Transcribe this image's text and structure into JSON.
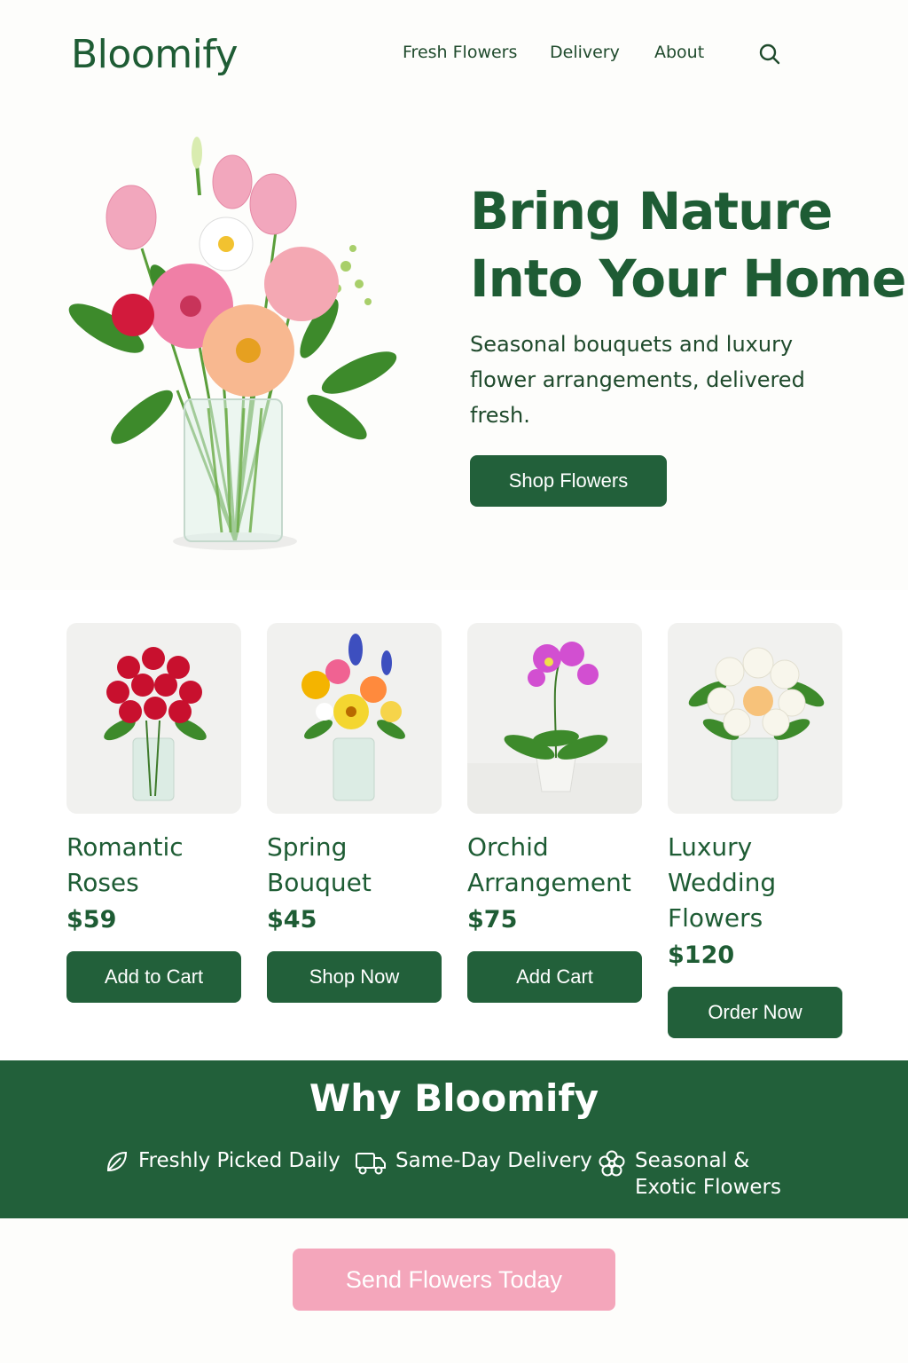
{
  "header": {
    "logo": "Bloomify",
    "nav": [
      "Fresh Flowers",
      "Delivery",
      "About"
    ],
    "search_icon": "search-icon"
  },
  "hero": {
    "title_line1": "Bring Nature",
    "title_line2": "Into Your Home",
    "subtitle": "Seasonal bouquets and luxury flower arrangements, delivered fresh.",
    "button": "Shop Flowers"
  },
  "products": [
    {
      "name": "Romantic Roses",
      "price": "$59",
      "button": "Add to Cart"
    },
    {
      "name": "Spring Bouquet",
      "price": "$45",
      "button": "Shop Now"
    },
    {
      "name": "Orchid Arrangement",
      "price": "$75",
      "button": "Add Cart"
    },
    {
      "name": "Luxury Wedding Flowers",
      "price": "$120",
      "button": "Order Now"
    }
  ],
  "why": {
    "title": "Why Bloomify",
    "features": [
      {
        "icon": "leaf-icon",
        "label": "Freshly Picked Daily"
      },
      {
        "icon": "truck-icon",
        "label": "Same-Day Delivery"
      },
      {
        "icon": "flower-icon",
        "label": "Seasonal & Exotic Flowers"
      }
    ]
  },
  "cta": {
    "label": "Send Flowers Today"
  },
  "colors": {
    "primary_green": "#22603a",
    "text_green": "#1e5c34",
    "cta_pink": "#f4a6bb",
    "background": "#fdfdfb"
  }
}
